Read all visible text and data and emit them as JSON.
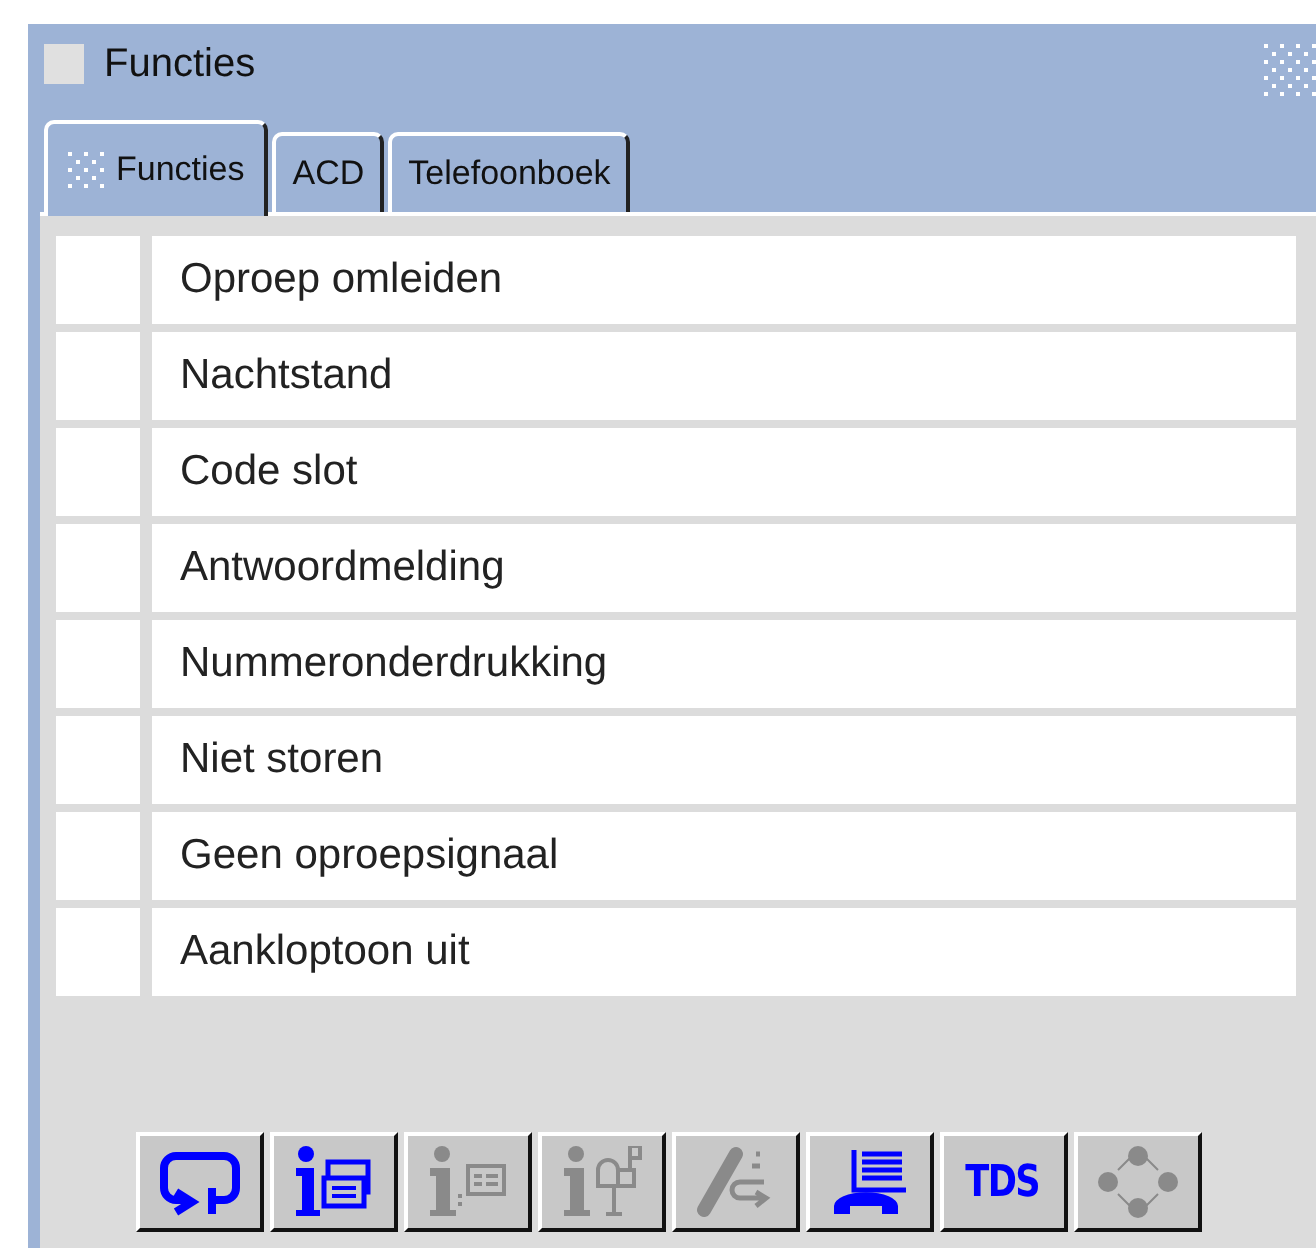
{
  "window": {
    "title": "Functies"
  },
  "tabs": [
    {
      "label": "Functies",
      "selected": true
    },
    {
      "label": "ACD",
      "selected": false
    },
    {
      "label": "Telefoonboek",
      "selected": false
    }
  ],
  "functions": [
    {
      "label": "Oproep omleiden"
    },
    {
      "label": "Nachtstand"
    },
    {
      "label": "Code slot"
    },
    {
      "label": "Antwoordmelding"
    },
    {
      "label": "Nummeronderdrukking"
    },
    {
      "label": "Niet storen"
    },
    {
      "label": "Geen oproepsignaal"
    },
    {
      "label": "Aankloptoon uit"
    }
  ],
  "toolbar": [
    {
      "kind": "loop",
      "enabled": true
    },
    {
      "kind": "infomail",
      "enabled": true
    },
    {
      "kind": "infocard",
      "enabled": false
    },
    {
      "kind": "infopost",
      "enabled": false
    },
    {
      "kind": "forward",
      "enabled": false
    },
    {
      "kind": "phonebook",
      "enabled": true
    },
    {
      "kind": "text",
      "label": "TDS",
      "enabled": true
    },
    {
      "kind": "dots",
      "enabled": false
    }
  ]
}
